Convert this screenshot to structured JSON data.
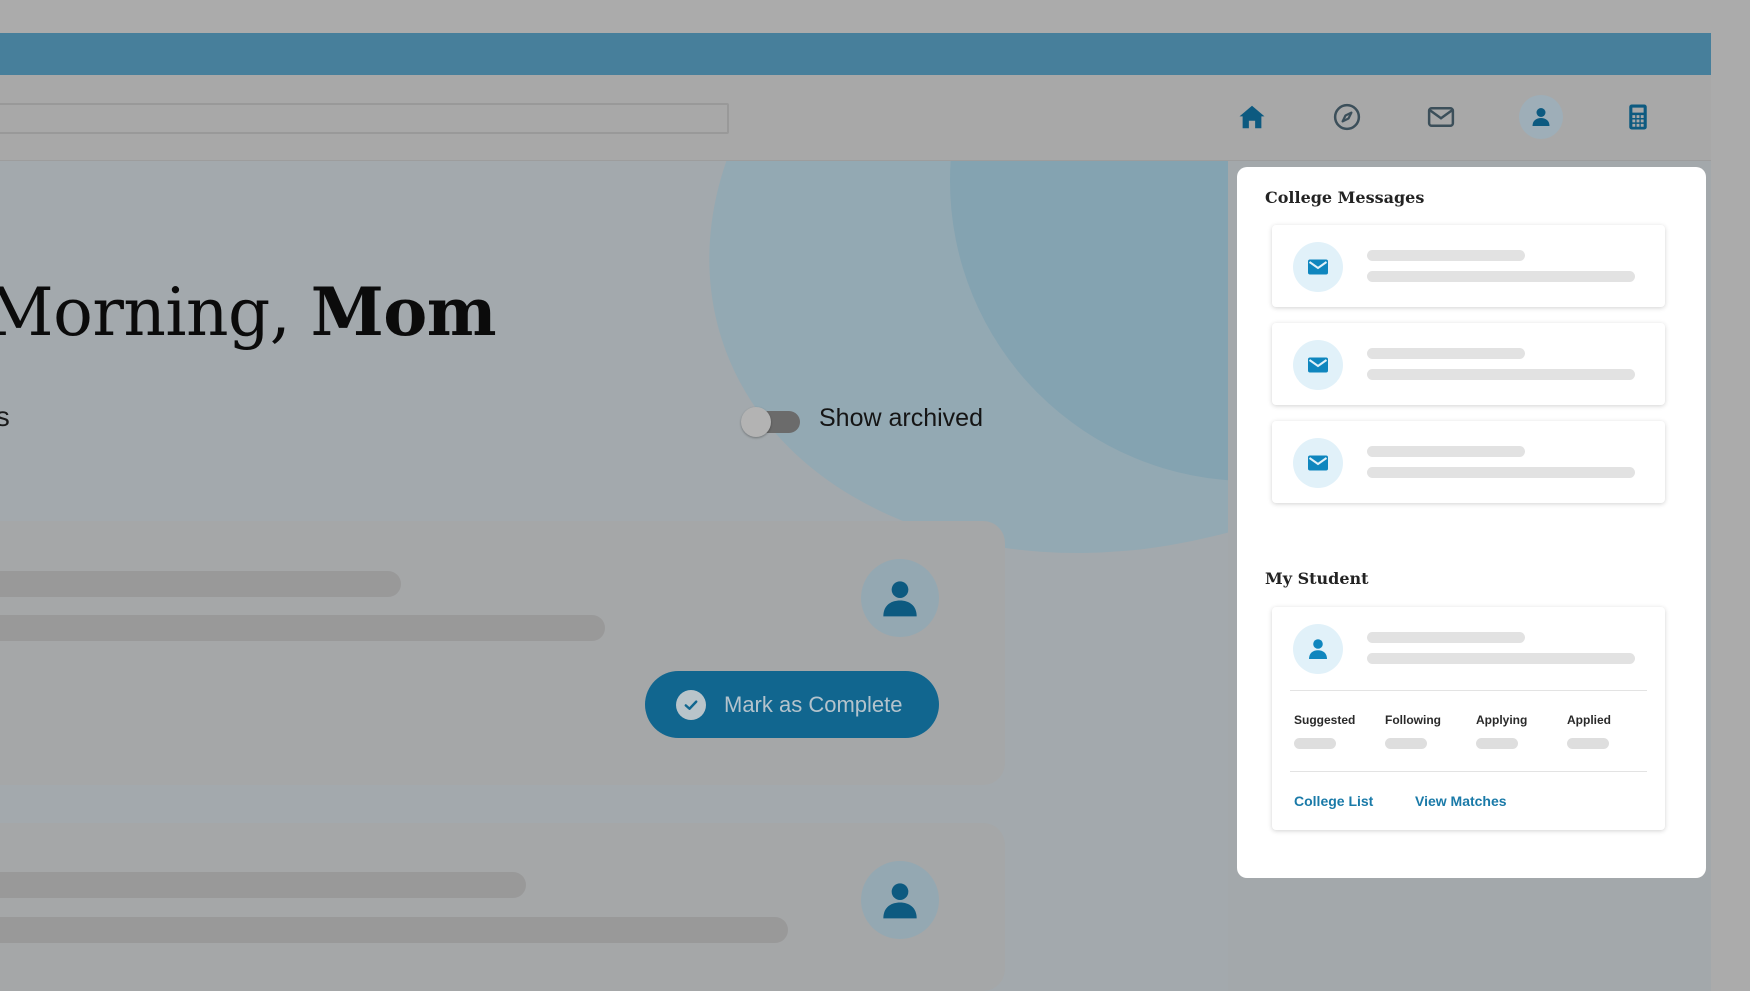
{
  "greeting": {
    "prefix": "Morning,",
    "name": "Mom"
  },
  "section": {
    "label": "ts"
  },
  "archive_toggle": {
    "label": "Show archived",
    "state": "off"
  },
  "task_card": {
    "action_label": "Mark as Complete"
  },
  "nav": {
    "icons": [
      "home-icon",
      "compass-icon",
      "mail-icon",
      "user-icon",
      "calculator-icon"
    ]
  },
  "sidebar": {
    "messages_title": "College Messages",
    "student_title": "My Student",
    "stats": [
      "Suggested",
      "Following",
      "Applying",
      "Applied"
    ],
    "links": {
      "college_list": "College List",
      "view_matches": "View Matches"
    }
  },
  "colors": {
    "topbar": "#477f9b",
    "accent": "#11668f",
    "link": "#1a7aa8",
    "icon_blue": "#0f86be"
  }
}
